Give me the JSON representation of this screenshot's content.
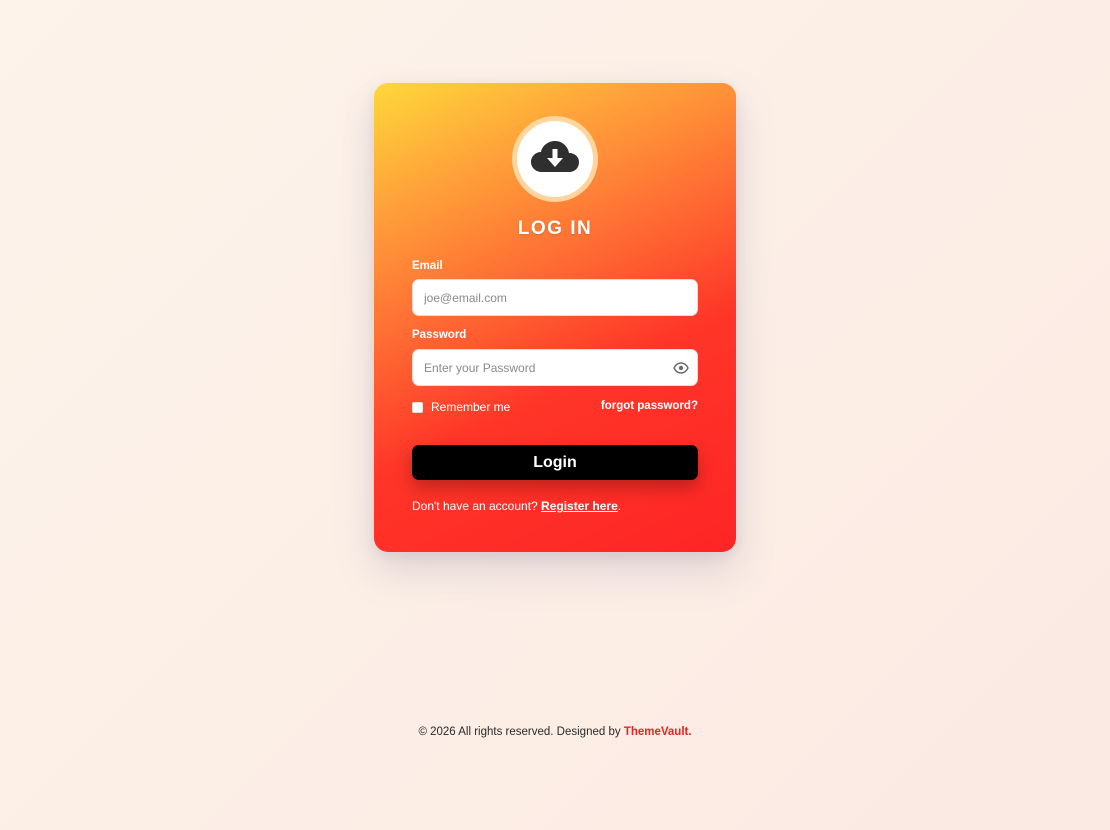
{
  "login_card": {
    "title": "LOG IN",
    "email": {
      "label": "Email",
      "placeholder": "joe@email.com",
      "value": ""
    },
    "password": {
      "label": "Password",
      "placeholder": "Enter your Password",
      "value": ""
    },
    "remember_label": "Remember me",
    "remember_checked": false,
    "forgot_label": "forgot password?",
    "login_button_label": "Login",
    "register_prompt": "Don't have an account? ",
    "register_link": "Register here",
    "register_suffix": "."
  },
  "icons": {
    "logo": "cloud-download-icon",
    "password_toggle": "eye-icon"
  },
  "footer": {
    "text": "© 2026 All rights reserved. Designed by ",
    "brand": "ThemeVault."
  },
  "colors": {
    "card_gradient_start": "#fed83a",
    "card_gradient_end": "#fe2525",
    "button": "#000000",
    "brand": "#e9231f"
  }
}
